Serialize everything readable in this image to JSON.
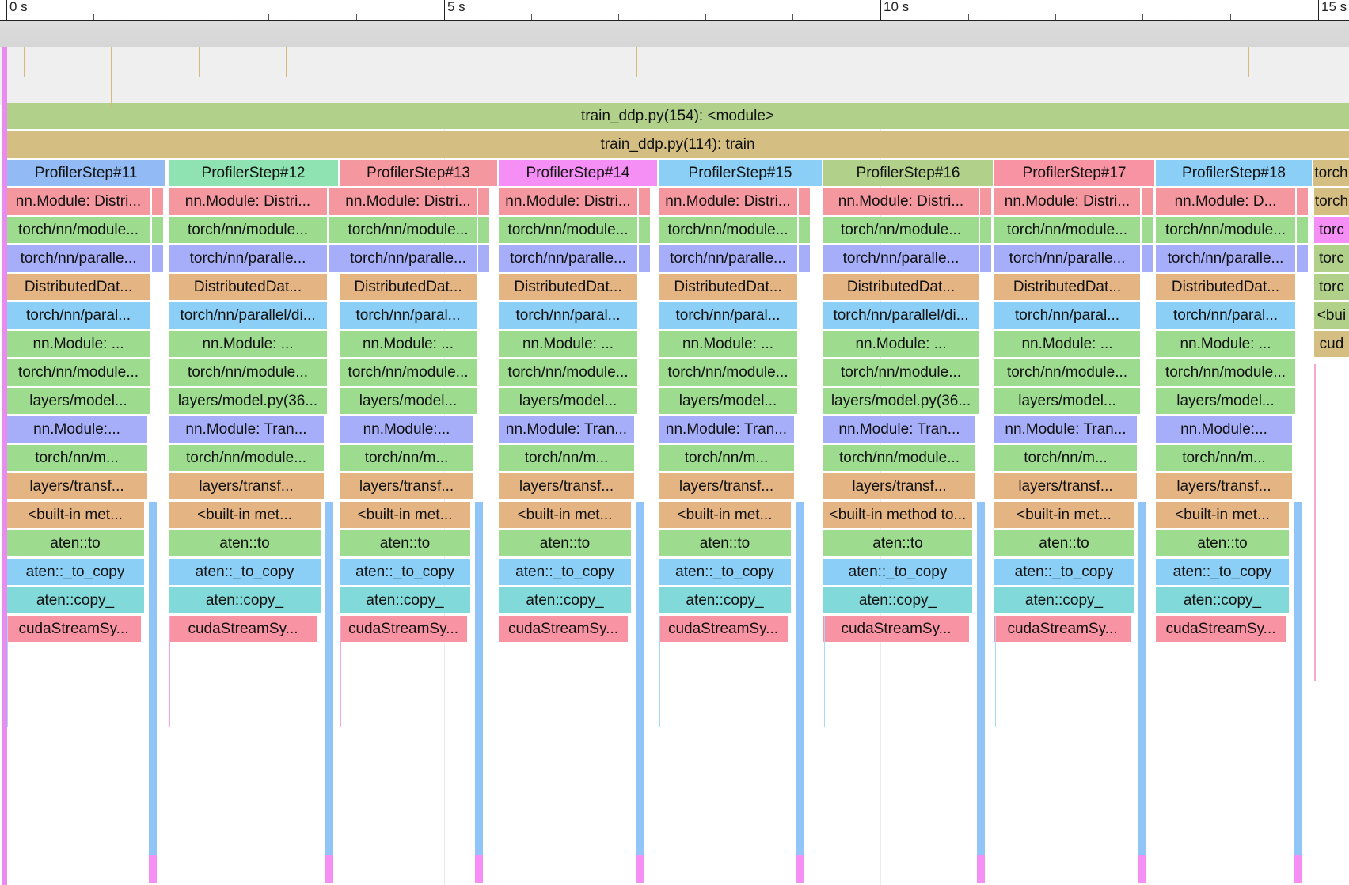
{
  "timeline": {
    "ticks": [
      "0 s",
      "5 s",
      "10 s",
      "15 s"
    ]
  },
  "rows": [
    [
      "train_ddp.py(154): <module>"
    ],
    [
      "train_ddp.py(114): train"
    ],
    [
      "ProfilerStep#11",
      "ProfilerStep#12",
      "ProfilerStep#13",
      "ProfilerStep#14",
      "ProfilerStep#15",
      "ProfilerStep#16",
      "ProfilerStep#17",
      "ProfilerStep#18",
      "torch"
    ],
    [
      "nn.Module: Distri...",
      "nn.Module: Distri...",
      "nn.Module: Distri...",
      "nn.Module: Distri...",
      "nn.Module: Distri...",
      "nn.Module: Distri...",
      "nn.Module: Distri...",
      "nn.Module: D...",
      "torch"
    ],
    [
      "torch/nn/module...",
      "torch/nn/module...",
      "torch/nn/module...",
      "torch/nn/module...",
      "torch/nn/module...",
      "torch/nn/module...",
      "torch/nn/module...",
      "torch/nn/module...",
      "torc"
    ],
    [
      "torch/nn/paralle...",
      "torch/nn/paralle...",
      "torch/nn/paralle...",
      "torch/nn/paralle...",
      "torch/nn/paralle...",
      "torch/nn/paralle...",
      "torch/nn/paralle...",
      "torch/nn/paralle...",
      "torc"
    ],
    [
      "DistributedDat...",
      "DistributedDat...",
      "DistributedDat...",
      "DistributedDat...",
      "DistributedDat...",
      "DistributedDat...",
      "DistributedDat...",
      "DistributedDat...",
      "torc"
    ],
    [
      "torch/nn/paral...",
      "torch/nn/parallel/di...",
      "torch/nn/paral...",
      "torch/nn/paral...",
      "torch/nn/paral...",
      "torch/nn/parallel/di...",
      "torch/nn/paral...",
      "torch/nn/paral...",
      "<bui"
    ],
    [
      "nn.Module: ...",
      "nn.Module: ...",
      "nn.Module: ...",
      "nn.Module: ...",
      "nn.Module: ...",
      "nn.Module: ...",
      "nn.Module: ...",
      "nn.Module: ...",
      "cud"
    ],
    [
      "torch/nn/module...",
      "torch/nn/module...",
      "torch/nn/module...",
      "torch/nn/module...",
      "torch/nn/module...",
      "torch/nn/module...",
      "torch/nn/module...",
      "torch/nn/module..."
    ],
    [
      "layers/model...",
      "layers/model.py(36...",
      "layers/model...",
      "layers/model...",
      "layers/model...",
      "layers/model.py(36...",
      "layers/model...",
      "layers/model..."
    ],
    [
      "nn.Module:...",
      "nn.Module: Tran...",
      "nn.Module:...",
      "nn.Module: Tran...",
      "nn.Module: Tran...",
      "nn.Module: Tran...",
      "nn.Module: Tran...",
      "nn.Module:..."
    ],
    [
      "torch/nn/m...",
      "torch/nn/module...",
      "torch/nn/m...",
      "torch/nn/m...",
      "torch/nn/m...",
      "torch/nn/module...",
      "torch/nn/m...",
      "torch/nn/m..."
    ],
    [
      "layers/transf...",
      "layers/transf...",
      "layers/transf...",
      "layers/transf...",
      "layers/transf...",
      "layers/transf...",
      "layers/transf...",
      "layers/transf..."
    ],
    [
      "<built-in met...",
      "<built-in met...",
      "<built-in met...",
      "<built-in met...",
      "<built-in met...",
      "<built-in method to...",
      "<built-in met...",
      "<built-in met..."
    ],
    [
      "aten::to",
      "aten::to",
      "aten::to",
      "aten::to",
      "aten::to",
      "aten::to",
      "aten::to",
      "aten::to"
    ],
    [
      "aten::_to_copy",
      "aten::_to_copy",
      "aten::_to_copy",
      "aten::_to_copy",
      "aten::_to_copy",
      "aten::_to_copy",
      "aten::_to_copy",
      "aten::_to_copy"
    ],
    [
      "aten::copy_",
      "aten::copy_",
      "aten::copy_",
      "aten::copy_",
      "aten::copy_",
      "aten::copy_",
      "aten::copy_",
      "aten::copy_"
    ],
    [
      "cudaStreamSy...",
      "cudaStreamSy...",
      "cudaStreamSy...",
      "cudaStreamSy...",
      "cudaStreamSy...",
      "cudaStreamSy...",
      "cudaStreamSy...",
      "cudaStreamSy..."
    ]
  ],
  "colors": {
    "row_colors": [
      "#b1d08a",
      "#d4be82",
      "#92bbf5",
      "#f4979e",
      "#9ddb8e",
      "#a7aef9",
      "#e5b483",
      "#8bcff7",
      "#9ddb8e",
      "#9ddb8e",
      "#9ddb8e",
      "#a7aef9",
      "#9ddb8e",
      "#e5b483",
      "#e5b483",
      "#9ddb8e",
      "#8bcff7",
      "#82d9d9",
      "#f793a2"
    ],
    "step_colors": [
      "#92bbf5",
      "#8fe2b1",
      "#f4979e",
      "#f58ef5",
      "#8bcff7",
      "#b1d08a",
      "#f793a2",
      "#8bcff7",
      "#d4be82"
    ],
    "last_col_colors": [
      "#d4be82",
      "#f58ef5",
      "#b1d08a",
      "#b1d08a",
      "#b1d08a",
      "#d4be82",
      "#f58ef5"
    ],
    "thin_bar": "#92c5f7",
    "thin_bar_end": "#f58ef5",
    "red_sliver": "#f77b8e",
    "counter_mark": "#d9b97a",
    "left_edge": "#e88cf0"
  }
}
